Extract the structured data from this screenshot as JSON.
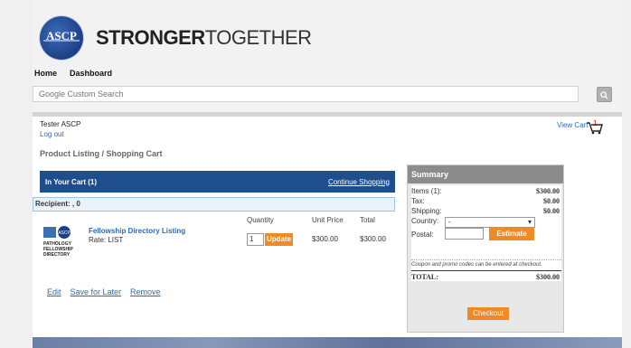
{
  "header": {
    "logo_text": "ASCP",
    "tagline_bold": "STRONGER",
    "tagline_light": "TOGETHER"
  },
  "nav": {
    "items": [
      "Home",
      "Dashboard"
    ]
  },
  "search": {
    "placeholder": "Google Custom Search"
  },
  "user": {
    "name": "Tester ASCP",
    "logout": "Log out",
    "view_cart": "View Cart",
    "cart_count": "1"
  },
  "breadcrumb": "Product Listing / Shopping Cart",
  "cart": {
    "header": "In Your Cart (1)",
    "continue": "Continue Shopping",
    "recipient": "Recipient: , 0",
    "columns": {
      "quantity": "Quantity",
      "unit_price": "Unit Price",
      "total": "Total"
    },
    "item": {
      "name": "Fellowship Directory Listing",
      "rate": "Rate: LIST",
      "image_label": "PATHOLOGY FELLOWSHIP DIRECTORY",
      "quantity": "1",
      "update": "Update",
      "unit_price": "$300.00",
      "total": "$300.00"
    },
    "actions": [
      "Edit",
      "Save for Later",
      "Remove"
    ]
  },
  "summary": {
    "title": "Summary",
    "items_label": "Items (1):",
    "items_value": "$300.00",
    "tax_label": "Tax:",
    "tax_value": "$0.00",
    "shipping_label": "Shipping:",
    "shipping_value": "$0.00",
    "country_label": "Country:",
    "country_value": "-",
    "postal_label": "Postal:",
    "estimate": "Estimate",
    "coupon_note": "Coupon and promo codes can be entered at checkout.",
    "total_label": "TOTAL:",
    "total_value": "$300.00",
    "checkout": "Checkout"
  },
  "colors": {
    "brand_blue": "#1f4e8c",
    "accent_orange": "#f08a24",
    "link_blue": "#2a6bb8"
  }
}
